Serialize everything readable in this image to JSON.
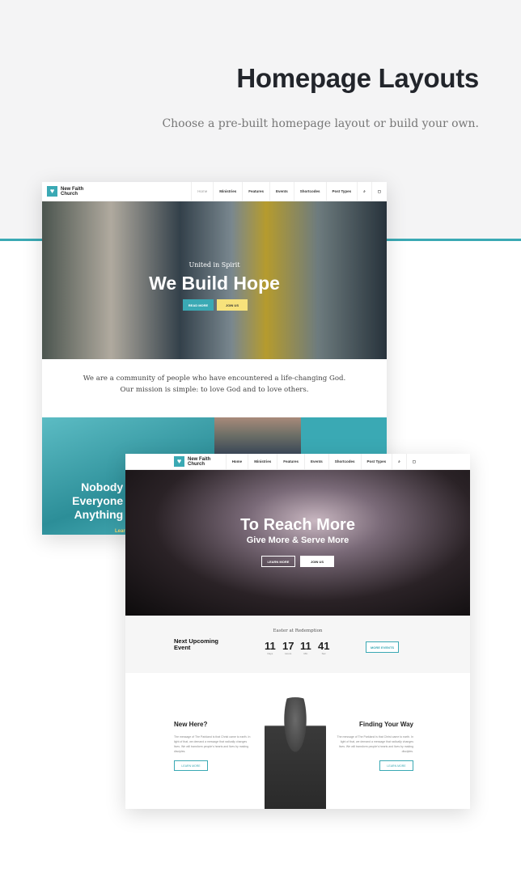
{
  "header": {
    "title": "Homepage Layouts",
    "subtitle": "Choose a pre-built homepage layout or build your own."
  },
  "brand": {
    "name": "New Faith Church",
    "accent": "#3aa9b4",
    "accent_yellow": "#f7e27b"
  },
  "nav": {
    "items": [
      "Home",
      "Ministries",
      "Features",
      "Events",
      "Shortcodes",
      "Post Types"
    ],
    "search_icon": "search-icon",
    "cart_icon": "cart-icon"
  },
  "layout1": {
    "hero": {
      "kicker": "United in Spirit",
      "title": "We Build Hope",
      "buttons": [
        "READ MORE",
        "JOIN US"
      ]
    },
    "intro": [
      "We are a community of people who have encountered a life-changing God.",
      "Our mission is simple: to love God and to love others."
    ],
    "strip": {
      "lines": [
        "Nobody i",
        "Everyone i",
        "Anything i"
      ],
      "link": "Lear"
    }
  },
  "layout2": {
    "hero": {
      "title": "To Reach More",
      "subtitle": "Give More & Serve More",
      "buttons": [
        "LEARN MORE",
        "JOIN US"
      ]
    },
    "event": {
      "label": "Next Upcoming Event",
      "name": "Easter at Redemption",
      "countdown": [
        {
          "v": "11",
          "u": "Days"
        },
        {
          "v": "17",
          "u": "Hours"
        },
        {
          "v": "11",
          "u": "Min"
        },
        {
          "v": "41",
          "u": "Sec"
        }
      ],
      "button": "MORE EVENTS"
    },
    "left": {
      "title": "New Here?",
      "text": "The message of The Parkland is that Christ came to earth. In light of that, we demand a message that radically changes lives. We will transform people's hearts and lives by making disciples.",
      "button": "LEARN MORE"
    },
    "right": {
      "title": "Finding Your Way",
      "text": "The message of The Parkland is that Christ came to earth. In light of that, we demand a message that radically changes lives. We will transform people's hearts and lives by making disciples.",
      "button": "LEARN MORE"
    }
  }
}
